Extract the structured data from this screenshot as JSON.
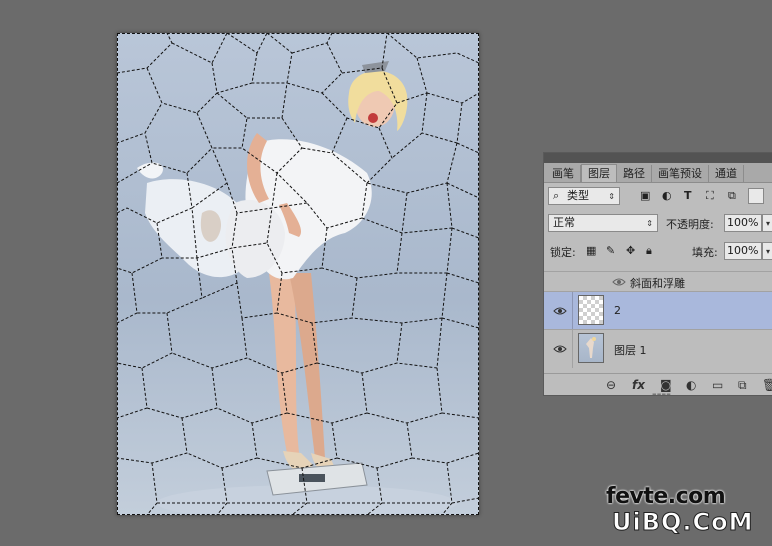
{
  "canvas": {
    "description_icon": "canvas-image",
    "colors": {
      "background": "#b2c0d3",
      "selection": "#111111"
    }
  },
  "panel": {
    "tabs": [
      {
        "label": "画笔",
        "active": false
      },
      {
        "label": "图层",
        "active": true
      },
      {
        "label": "路径",
        "active": false
      },
      {
        "label": "画笔预设",
        "active": false
      },
      {
        "label": "通道",
        "active": false
      }
    ],
    "filter": {
      "kind_label": "类型",
      "search_icon": "search-icon"
    },
    "blend_mode": "正常",
    "opacity": {
      "label": "不透明度:",
      "value": "100%"
    },
    "lock": {
      "label": "锁定:"
    },
    "fill": {
      "label": "填充:",
      "value": "100%"
    },
    "layers": [
      {
        "name": "斜面和浮雕",
        "type": "effect",
        "selected": false
      },
      {
        "name": "2",
        "type": "layer",
        "selected": true,
        "thumb": "transparent"
      },
      {
        "name": "图层 1",
        "type": "layer",
        "selected": false,
        "thumb": "photo"
      }
    ],
    "accent_selected": "#a9b8dc"
  },
  "watermark": {
    "line1": "fevte.com",
    "line2": "UiBQ.CoM"
  }
}
